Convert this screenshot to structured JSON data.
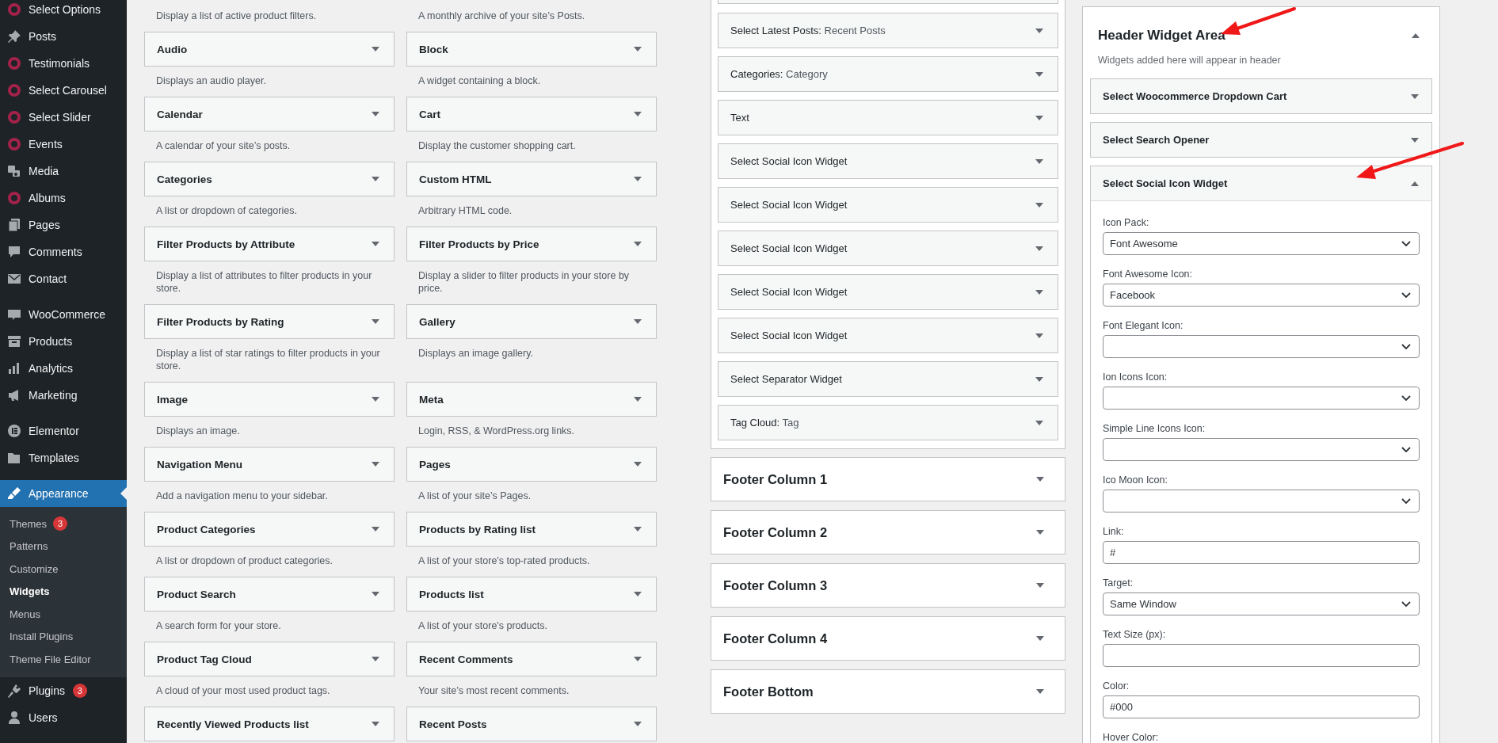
{
  "admin_menu": {
    "groups": [
      [
        {
          "label": "Select Options",
          "selected": false
        },
        {
          "label": "Posts",
          "selected": false
        },
        {
          "label": "Testimonials",
          "selected": false
        },
        {
          "label": "Select Carousel",
          "selected": false
        },
        {
          "label": "Select Slider",
          "selected": false
        },
        {
          "label": "Events",
          "selected": false
        },
        {
          "label": "Media",
          "selected": false
        },
        {
          "label": "Albums",
          "selected": false
        },
        {
          "label": "Pages",
          "selected": false
        },
        {
          "label": "Comments",
          "selected": false
        },
        {
          "label": "Contact",
          "selected": false
        }
      ],
      [
        {
          "label": "WooCommerce",
          "selected": false
        },
        {
          "label": "Products",
          "selected": false
        },
        {
          "label": "Analytics",
          "selected": false
        },
        {
          "label": "Marketing",
          "selected": false
        }
      ],
      [
        {
          "label": "Elementor",
          "selected": false
        },
        {
          "label": "Templates",
          "selected": false
        }
      ],
      [
        {
          "label": "Appearance",
          "selected": true,
          "submenu": [
            {
              "label": "Themes",
              "badge": "3",
              "selected": false
            },
            {
              "label": "Patterns",
              "selected": false
            },
            {
              "label": "Customize",
              "selected": false
            },
            {
              "label": "Widgets",
              "selected": true
            },
            {
              "label": "Menus",
              "selected": false
            },
            {
              "label": "Install Plugins",
              "selected": false
            },
            {
              "label": "Theme File Editor",
              "selected": false
            }
          ]
        },
        {
          "label": "Plugins",
          "badge": "3",
          "selected": false
        },
        {
          "label": "Users",
          "selected": false
        }
      ]
    ]
  },
  "available_widgets": [
    {
      "description": "Display a list of active product filters."
    },
    {
      "description": "A monthly archive of your site’s Posts."
    },
    {
      "title": "Audio",
      "description": "Displays an audio player."
    },
    {
      "title": "Block",
      "description": "A widget containing a block."
    },
    {
      "title": "Calendar",
      "description": "A calendar of your site’s posts."
    },
    {
      "title": "Cart",
      "description": "Display the customer shopping cart."
    },
    {
      "title": "Categories",
      "description": "A list or dropdown of categories."
    },
    {
      "title": "Custom HTML",
      "description": "Arbitrary HTML code."
    },
    {
      "title": "Filter Products by Attribute",
      "description": "Display a list of attributes to filter products in your store."
    },
    {
      "title": "Filter Products by Price",
      "description": "Display a slider to filter products in your store by price."
    },
    {
      "title": "Filter Products by Rating",
      "description": "Display a list of star ratings to filter products in your store."
    },
    {
      "title": "Gallery",
      "description": "Displays an image gallery."
    },
    {
      "title": "Image",
      "description": "Displays an image."
    },
    {
      "title": "Meta",
      "description": "Login, RSS, & WordPress.org links."
    },
    {
      "title": "Navigation Menu",
      "description": "Add a navigation menu to your sidebar."
    },
    {
      "title": "Pages",
      "description": "A list of your site’s Pages."
    },
    {
      "title": "Product Categories",
      "description": "A list or dropdown of product categories."
    },
    {
      "title": "Products by Rating list",
      "description": "A list of your store's top-rated products."
    },
    {
      "title": "Product Search",
      "description": "A search form for your store."
    },
    {
      "title": "Products list",
      "description": "A list of your store's products."
    },
    {
      "title": "Product Tag Cloud",
      "description": "A cloud of your most used product tags."
    },
    {
      "title": "Recent Comments",
      "description": "Your site’s most recent comments."
    },
    {
      "title": "Recently Viewed Products list"
    },
    {
      "title": "Recent Posts"
    }
  ],
  "sidebar_widgets": [
    {
      "title": "Select Latest Posts:",
      "subtitle": "Recent Posts"
    },
    {
      "title": "Categories:",
      "subtitle": "Category"
    },
    {
      "title": "Text"
    },
    {
      "title": "Select Social Icon Widget"
    },
    {
      "title": "Select Social Icon Widget"
    },
    {
      "title": "Select Social Icon Widget"
    },
    {
      "title": "Select Social Icon Widget"
    },
    {
      "title": "Select Social Icon Widget"
    },
    {
      "title": "Select Separator Widget"
    },
    {
      "title": "Tag Cloud:",
      "subtitle": "Tag"
    }
  ],
  "widget_areas": [
    {
      "title": "Footer Column 1",
      "expanded": false
    },
    {
      "title": "Footer Column 2",
      "expanded": false
    },
    {
      "title": "Footer Column 3",
      "expanded": false
    },
    {
      "title": "Footer Column 4",
      "expanded": false
    },
    {
      "title": "Footer Bottom",
      "expanded": false
    }
  ],
  "header_widget_area": {
    "title": "Header Widget Area",
    "expanded": true,
    "description": "Widgets added here will appear in header",
    "widgets": [
      {
        "title": "Select Woocommerce Dropdown Cart",
        "expanded": false
      },
      {
        "title": "Select Search Opener",
        "expanded": false
      },
      {
        "title": "Select Social Icon Widget",
        "expanded": true,
        "fields": [
          {
            "label": "Icon Pack:",
            "kind": "select",
            "value": "Font Awesome"
          },
          {
            "label": "Font Awesome Icon:",
            "kind": "select",
            "value": "Facebook"
          },
          {
            "label": "Font Elegant Icon:",
            "kind": "select"
          },
          {
            "label": "Ion Icons Icon:",
            "kind": "select"
          },
          {
            "label": "Simple Line Icons Icon:",
            "kind": "select"
          },
          {
            "label": "Ico Moon Icon:",
            "kind": "select"
          },
          {
            "label": "Link:",
            "kind": "text",
            "value": "#"
          },
          {
            "label": "Target:",
            "kind": "select",
            "value": "Same Window"
          },
          {
            "label": "Text Size (px):",
            "kind": "text"
          },
          {
            "label": "Color:",
            "kind": "text",
            "value": "#000"
          },
          {
            "label": "Hover Color:",
            "kind": "text"
          }
        ]
      }
    ]
  }
}
